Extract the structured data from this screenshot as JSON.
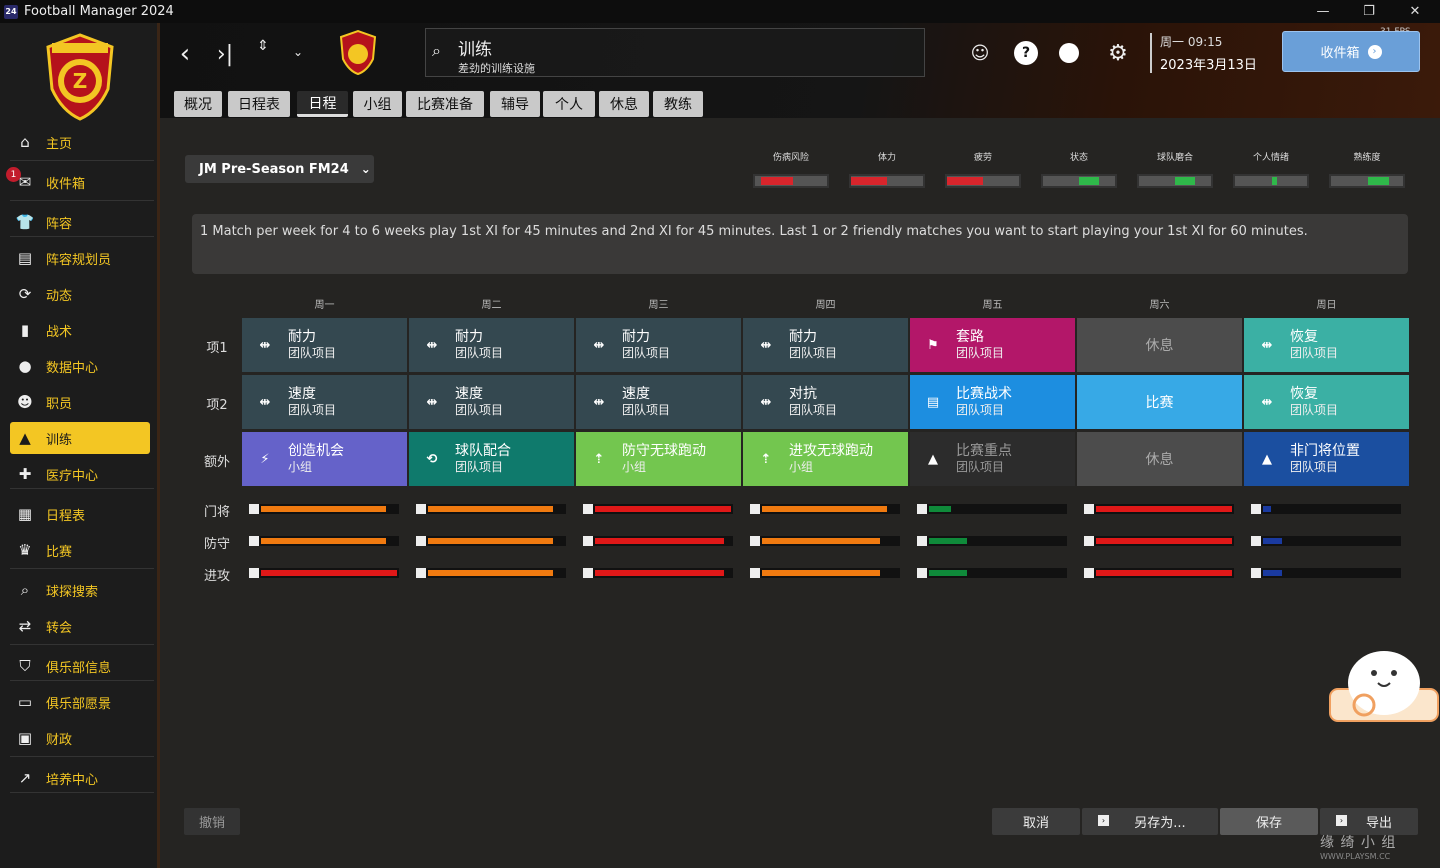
{
  "window": {
    "title": "Football Manager 2024",
    "icon_text": "24"
  },
  "sidebar": {
    "items": [
      {
        "label": "主页",
        "icon": "home-icon"
      },
      {
        "label": "收件箱",
        "icon": "inbox-icon",
        "badge": "1"
      },
      {
        "label": "阵容",
        "icon": "squad-icon"
      },
      {
        "label": "阵容规划员",
        "icon": "clipboard-icon"
      },
      {
        "label": "动态",
        "icon": "dynamics-icon"
      },
      {
        "label": "战术",
        "icon": "tactics-icon"
      },
      {
        "label": "数据中心",
        "icon": "data-hub-icon"
      },
      {
        "label": "职员",
        "icon": "staff-icon"
      },
      {
        "label": "训练",
        "icon": "training-cone-icon"
      },
      {
        "label": "医疗中心",
        "icon": "medical-icon"
      },
      {
        "label": "日程表",
        "icon": "calendar-icon"
      },
      {
        "label": "比赛",
        "icon": "trophy-icon"
      },
      {
        "label": "球探搜索",
        "icon": "scouting-icon"
      },
      {
        "label": "转会",
        "icon": "transfers-icon"
      },
      {
        "label": "俱乐部信息",
        "icon": "shield-icon"
      },
      {
        "label": "俱乐部愿景",
        "icon": "briefcase-icon"
      },
      {
        "label": "财政",
        "icon": "finance-icon"
      },
      {
        "label": "培养中心",
        "icon": "development-icon"
      }
    ]
  },
  "header": {
    "search_title": "训练",
    "search_subtitle": "差劲的训练设施",
    "clock_day_time": "周一 09:15",
    "clock_date": "2023年3月13日",
    "inbox_label": "收件箱",
    "fps": "31 FPS"
  },
  "tabs": [
    "概况",
    "日程表",
    "日程",
    "小组",
    "比赛准备",
    "辅导",
    "个人",
    "休息",
    "教练"
  ],
  "active_tab": "日程",
  "schedule_name": "JM Pre-Season FM24",
  "meters": [
    {
      "label": "伤病风险",
      "color": "#d8252c",
      "start": 0.08,
      "fill": 0.45
    },
    {
      "label": "体力",
      "color": "#d8252c",
      "start": 0.0,
      "fill": 0.5
    },
    {
      "label": "疲劳",
      "color": "#d8252c",
      "start": 0.0,
      "fill": 0.5
    },
    {
      "label": "状态",
      "color": "#2fb84a",
      "start": 0.5,
      "fill": 0.28
    },
    {
      "label": "球队磨合",
      "color": "#2fb84a",
      "start": 0.5,
      "fill": 0.28
    },
    {
      "label": "个人情绪",
      "color": "#2fb84a",
      "start": 0.52,
      "fill": 0.06
    },
    {
      "label": "熟练度",
      "color": "#2fb84a",
      "start": 0.52,
      "fill": 0.28
    }
  ],
  "description": "1 Match per week for 4 to 6 weeks play 1st XI for 45 minutes and 2nd XI for 45 minutes. Last 1 or 2 friendly matches you want to start playing your 1st XI for 60 minutes.",
  "days": [
    "周一",
    "周二",
    "周三",
    "周四",
    "周五",
    "周六",
    "周日"
  ],
  "row_labels": [
    "项1",
    "项2",
    "额外"
  ],
  "sessions": [
    [
      {
        "title": "耐力",
        "sub": "团队项目",
        "icon": "⇹",
        "bg": "#344850"
      },
      {
        "title": "耐力",
        "sub": "团队项目",
        "icon": "⇹",
        "bg": "#344850"
      },
      {
        "title": "耐力",
        "sub": "团队项目",
        "icon": "⇹",
        "bg": "#344850"
      },
      {
        "title": "耐力",
        "sub": "团队项目",
        "icon": "⇹",
        "bg": "#344850"
      },
      {
        "title": "套路",
        "sub": "团队项目",
        "icon": "⚑",
        "bg": "#b31769"
      },
      {
        "title": "休息",
        "sub": "",
        "icon": "",
        "bg": "#4c4c4c",
        "center": true
      },
      {
        "title": "恢复",
        "sub": "团队项目",
        "icon": "⇹",
        "bg": "#3bb0a4"
      }
    ],
    [
      {
        "title": "速度",
        "sub": "团队项目",
        "icon": "⇹",
        "bg": "#344850"
      },
      {
        "title": "速度",
        "sub": "团队项目",
        "icon": "⇹",
        "bg": "#344850"
      },
      {
        "title": "速度",
        "sub": "团队项目",
        "icon": "⇹",
        "bg": "#344850"
      },
      {
        "title": "对抗",
        "sub": "团队项目",
        "icon": "⇹",
        "bg": "#344850"
      },
      {
        "title": "比赛战术",
        "sub": "团队项目",
        "icon": "▤",
        "bg": "#1d8ee0"
      },
      {
        "title": "比赛",
        "sub": "",
        "icon": "",
        "bg": "#37a9e6",
        "center": true
      },
      {
        "title": "恢复",
        "sub": "团队项目",
        "icon": "⇹",
        "bg": "#3bb0a4"
      }
    ],
    [
      {
        "title": "创造机会",
        "sub": "小组",
        "icon": "⚡",
        "bg": "#6562c9"
      },
      {
        "title": "球队配合",
        "sub": "团队项目",
        "icon": "⟲",
        "bg": "#0f7a6c"
      },
      {
        "title": "防守无球跑动",
        "sub": "小组",
        "icon": "⇡",
        "bg": "#73c64f"
      },
      {
        "title": "进攻无球跑动",
        "sub": "小组",
        "icon": "⇡",
        "bg": "#73c64f"
      },
      {
        "title": "比赛重点",
        "sub": "团队项目",
        "icon": "▲",
        "bg": "#2c2c2c",
        "dim": true
      },
      {
        "title": "休息",
        "sub": "",
        "icon": "",
        "bg": "#4c4c4c",
        "center": true
      },
      {
        "title": "非门将位置",
        "sub": "团队项目",
        "icon": "▲",
        "bg": "#1b4fa0"
      }
    ]
  ],
  "load_rows": [
    {
      "label": "门将",
      "bars": [
        {
          "color": "#f07a10",
          "fill": 0.92
        },
        {
          "color": "#f07a10",
          "fill": 0.92
        },
        {
          "color": "#e01818",
          "fill": 1.0
        },
        {
          "color": "#f07a10",
          "fill": 0.92
        },
        {
          "color": "#0f8a3a",
          "fill": 0.16
        },
        {
          "color": "#e01818",
          "fill": 1.0
        },
        {
          "color": "#1a3aa0",
          "fill": 0.06
        }
      ]
    },
    {
      "label": "防守",
      "bars": [
        {
          "color": "#f07a10",
          "fill": 0.92
        },
        {
          "color": "#f07a10",
          "fill": 0.92
        },
        {
          "color": "#e01818",
          "fill": 0.95
        },
        {
          "color": "#f07a10",
          "fill": 0.87
        },
        {
          "color": "#0f8a3a",
          "fill": 0.28
        },
        {
          "color": "#e01818",
          "fill": 1.0
        },
        {
          "color": "#1a3aa0",
          "fill": 0.14
        }
      ]
    },
    {
      "label": "进攻",
      "bars": [
        {
          "color": "#e01818",
          "fill": 1.0
        },
        {
          "color": "#f07a10",
          "fill": 0.92
        },
        {
          "color": "#e01818",
          "fill": 0.95
        },
        {
          "color": "#f07a10",
          "fill": 0.87
        },
        {
          "color": "#0f8a3a",
          "fill": 0.28
        },
        {
          "color": "#e01818",
          "fill": 1.0
        },
        {
          "color": "#1a3aa0",
          "fill": 0.14
        }
      ]
    }
  ],
  "buttons": {
    "undo": "撤销",
    "cancel": "取消",
    "save_as": "另存为...",
    "save": "保存",
    "export": "导出"
  },
  "watermark": {
    "line1": "缘 绮 小 组",
    "line2": "WWW.PLAYSM.CC"
  },
  "colors": {
    "accent": "#f3c623",
    "header_orange": "#c2410c"
  }
}
